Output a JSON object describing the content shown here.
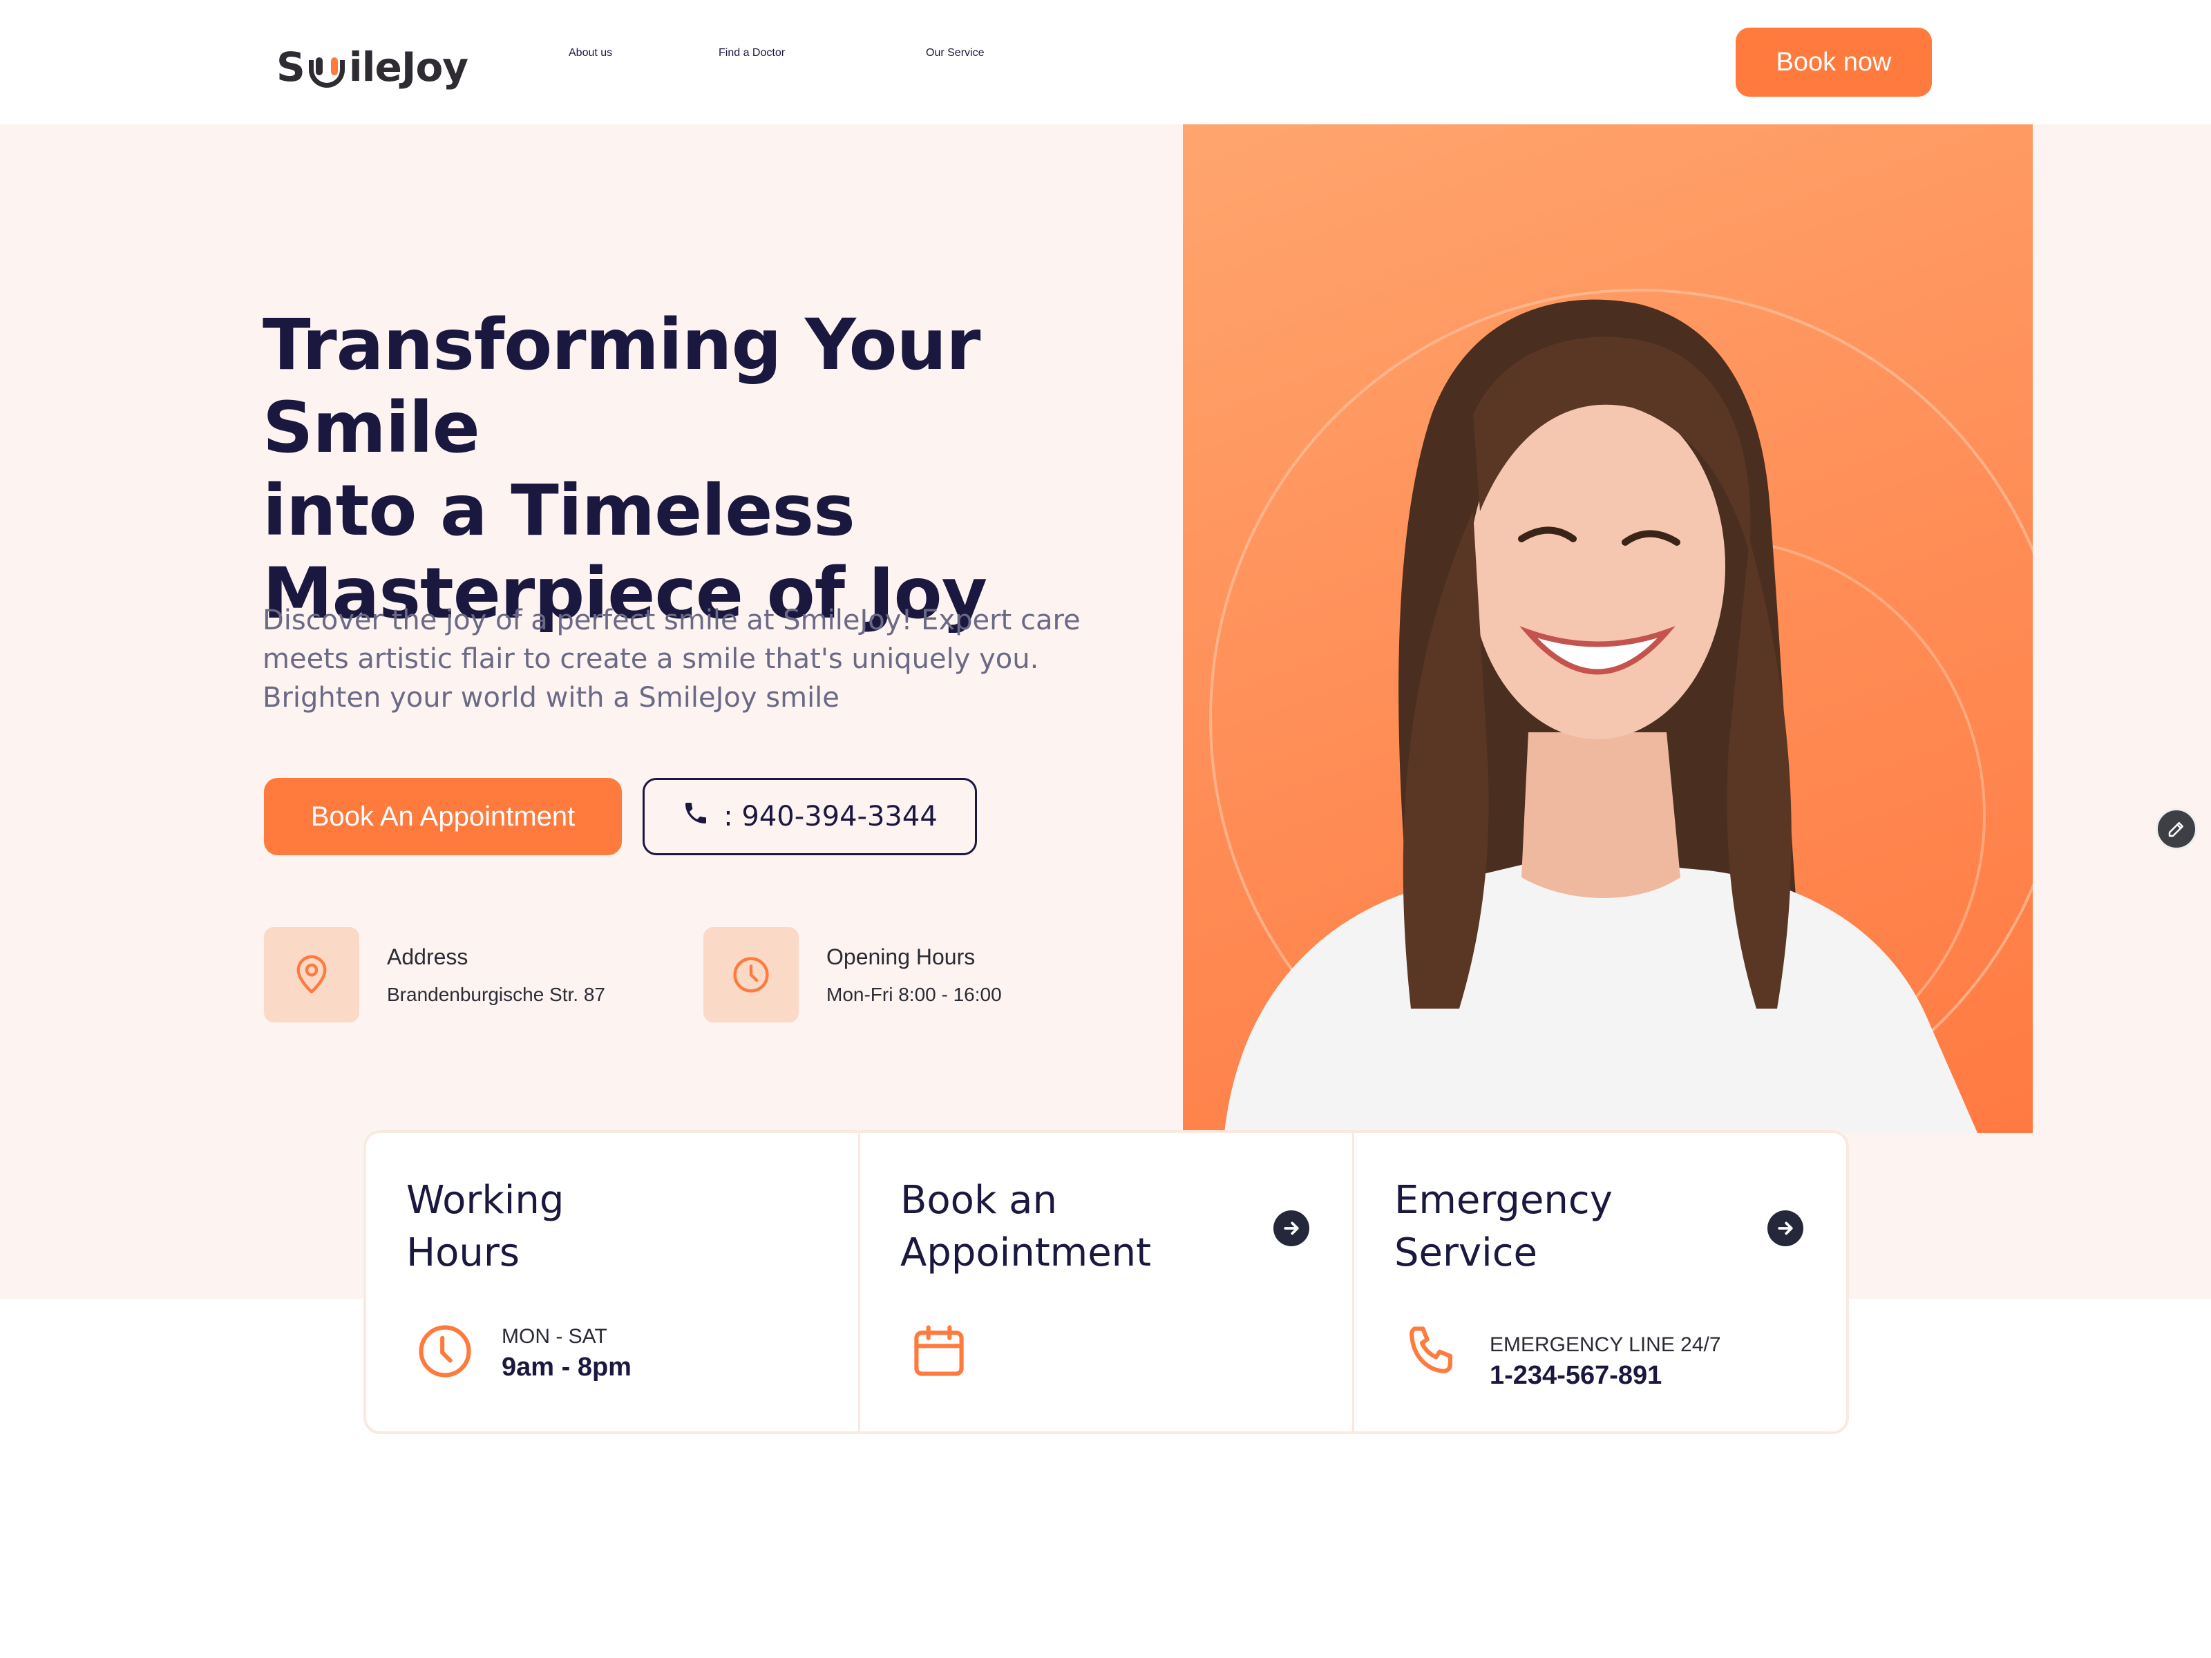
{
  "header": {
    "logo": {
      "prefix": "S",
      "suffix": "ileJoy"
    },
    "nav": [
      {
        "label": "About us"
      },
      {
        "label": "Find a Doctor"
      },
      {
        "label": "Our Service"
      }
    ],
    "book_now_label": "Book now"
  },
  "hero": {
    "title_lines": [
      "Transforming Your Smile",
      "into a Timeless",
      "Masterpiece of Joy"
    ],
    "description": "Discover the joy of a perfect smile at SmileJoy! Expert care meets artistic flair to create a smile that's uniquely you. Brighten your world with a SmileJoy smile",
    "appointment_button": "Book An Appointment",
    "phone_button": ": 940-394-3344",
    "info": [
      {
        "label": "Address",
        "value": "Brandenburgische Str. 87",
        "icon": "location-pin-icon"
      },
      {
        "label": "Opening Hours",
        "value": "Mon-Fri 8:00 - 16:00",
        "icon": "clock-icon"
      }
    ]
  },
  "cards": [
    {
      "title_lines": [
        "Working",
        "Hours"
      ],
      "small": "MON - SAT",
      "big": "9am - 8pm",
      "icon": "clock-icon"
    },
    {
      "title_lines": [
        "Book an",
        "Appointment"
      ],
      "icon": "calendar-icon",
      "arrow": "arrow-right-icon"
    },
    {
      "title_lines": [
        "Emergency",
        "Service"
      ],
      "small": "EMERGENCY LINE 24/7",
      "big": "1-234-567-891",
      "icon": "phone-icon",
      "arrow": "arrow-right-icon"
    }
  ],
  "colors": {
    "accent": "#ff7a3d",
    "heading": "#1b1840",
    "hero_background": "#fdf4f1",
    "icon_box": "#fbd9c7"
  }
}
